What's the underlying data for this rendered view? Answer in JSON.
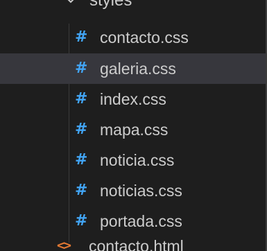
{
  "explorer": {
    "folder": {
      "name": "styles",
      "icon": "chevron-down-icon",
      "expanded": true
    },
    "files": [
      {
        "icon": "#",
        "icon_name": "css-hash-icon",
        "name": "contacto.css",
        "selected": false
      },
      {
        "icon": "#",
        "icon_name": "css-hash-icon",
        "name": "galeria.css",
        "selected": true
      },
      {
        "icon": "#",
        "icon_name": "css-hash-icon",
        "name": "index.css",
        "selected": false
      },
      {
        "icon": "#",
        "icon_name": "css-hash-icon",
        "name": "mapa.css",
        "selected": false
      },
      {
        "icon": "#",
        "icon_name": "css-hash-icon",
        "name": "noticia.css",
        "selected": false
      },
      {
        "icon": "#",
        "icon_name": "css-hash-icon",
        "name": "noticias.css",
        "selected": false
      },
      {
        "icon": "#",
        "icon_name": "css-hash-icon",
        "name": "portada.css",
        "selected": false
      }
    ],
    "next_file": {
      "icon": "<>",
      "icon_name": "html-icon",
      "name": "contacto.html"
    }
  },
  "colors": {
    "background": "#1e1e1e",
    "selected_row": "#37373d",
    "text": "#cccccc",
    "css_icon": "#42a5f5",
    "html_icon": "#e37933"
  }
}
